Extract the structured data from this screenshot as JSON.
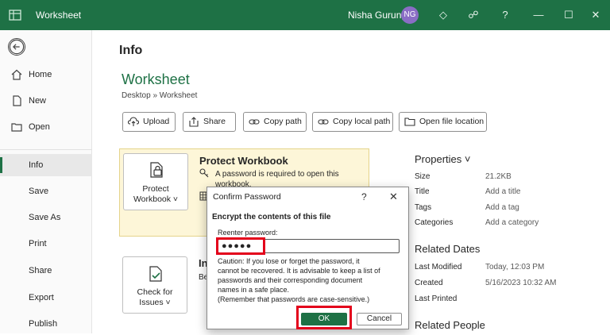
{
  "titlebar": {
    "doc_title": "Worksheet",
    "user_name": "Nisha Gurung",
    "avatar_initials": "NG"
  },
  "sidebar": {
    "items": [
      {
        "label": "Home",
        "icon": "home-icon"
      },
      {
        "label": "New",
        "icon": "new-file-icon"
      },
      {
        "label": "Open",
        "icon": "folder-icon"
      },
      {
        "label": "Info"
      },
      {
        "label": "Save"
      },
      {
        "label": "Save As"
      },
      {
        "label": "Print"
      },
      {
        "label": "Share"
      },
      {
        "label": "Export"
      },
      {
        "label": "Publish"
      }
    ]
  },
  "main": {
    "heading": "Info",
    "doc_name": "Worksheet",
    "path": "Desktop » Worksheet",
    "actions": [
      "Upload",
      "Share",
      "Copy path",
      "Copy local path",
      "Open file location"
    ]
  },
  "protect": {
    "tile_label_1": "Protect",
    "tile_label_2": "Workbook ˅",
    "title": "Protect Workbook",
    "text_1": "A password is required to open this",
    "text_2": "workbook."
  },
  "inspect": {
    "tile_label_1": "Check for",
    "tile_label_2": "Issues ˅",
    "title_fragment": "In",
    "line_fragment": "Be"
  },
  "properties": {
    "heading": "Properties ˅",
    "rows": [
      {
        "label": "Size",
        "value": "21.2KB"
      },
      {
        "label": "Title",
        "value": "Add a title"
      },
      {
        "label": "Tags",
        "value": "Add a tag"
      },
      {
        "label": "Categories",
        "value": "Add a category"
      }
    ],
    "related_dates_heading": "Related Dates",
    "dates": [
      {
        "label": "Last Modified",
        "value": "Today, 12:03 PM"
      },
      {
        "label": "Created",
        "value": "5/16/2023 10:32 AM"
      },
      {
        "label": "Last Printed",
        "value": ""
      }
    ],
    "related_people_heading": "Related People"
  },
  "dialog": {
    "title": "Confirm Password",
    "heading": "Encrypt the contents of this file",
    "reenter_label": "Reenter password:",
    "password_value": "●●●●●",
    "caution_1": "Caution: If you lose or forget the password, it",
    "caution_2": "cannot be recovered. It is advisable to keep a list of",
    "caution_3": "passwords and their corresponding document",
    "caution_4": "names in a safe place.",
    "caution_5": "(Remember that passwords are case-sensitive.)",
    "ok_label": "OK",
    "cancel_label": "Cancel"
  }
}
